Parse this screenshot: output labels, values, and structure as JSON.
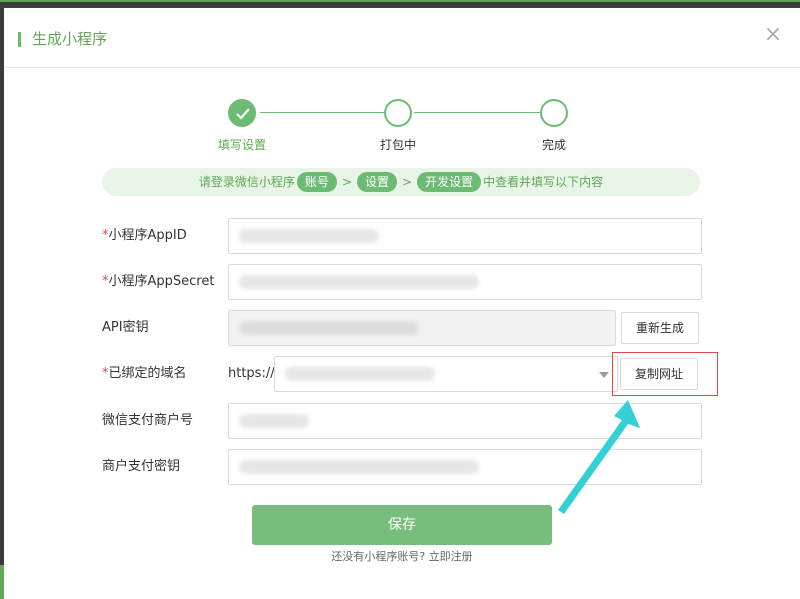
{
  "modal": {
    "title": "生成小程序",
    "close_symbol": "×"
  },
  "steps": [
    {
      "label": "填写设置",
      "state": "done"
    },
    {
      "label": "打包中",
      "state": "pending"
    },
    {
      "label": "完成",
      "state": "pending"
    }
  ],
  "hint": {
    "prefix": "请登录微信小程序",
    "pill1": "账号",
    "sep1": ">",
    "pill2": "设置",
    "sep2": ">",
    "pill3": "开发设置",
    "suffix": "中查看并填写以下内容"
  },
  "form": {
    "appid_label": "小程序AppID",
    "appsecret_label": "小程序AppSecret",
    "apikey_label": "API密钥",
    "regen_button": "重新生成",
    "domain_label": "已绑定的域名",
    "domain_prefix": "https://",
    "copy_button": "复制网址",
    "mchid_label": "微信支付商户号",
    "paykey_label": "商户支付密钥",
    "required_mark": "*"
  },
  "actions": {
    "save": "保存",
    "register_text": "还没有小程序账号?",
    "register_link": "立即注册"
  },
  "colors": {
    "accent": "#6cbb72",
    "required": "#e04848",
    "arrow": "#33d1d6"
  }
}
